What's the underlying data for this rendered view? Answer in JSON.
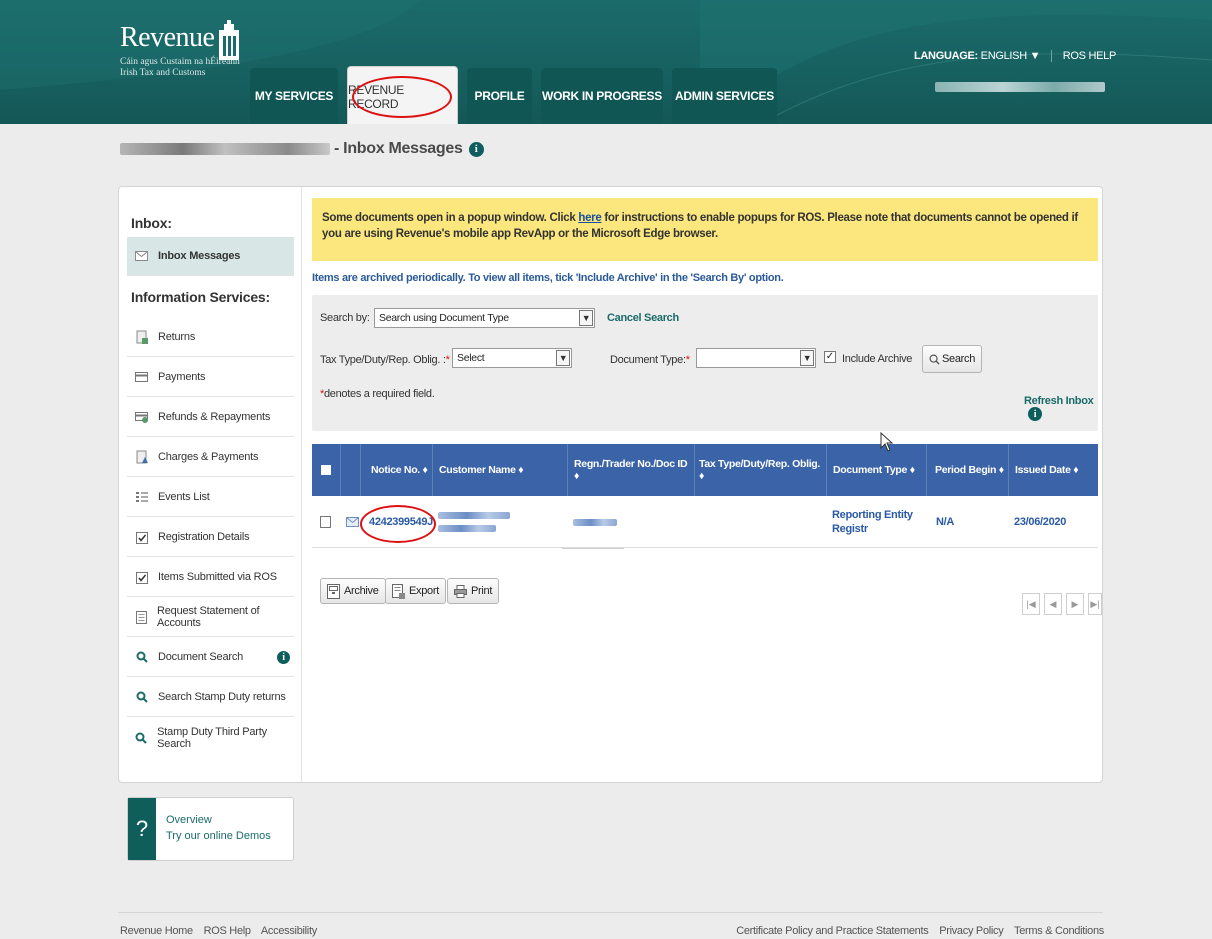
{
  "header": {
    "logo": {
      "word": "Revenue",
      "sub1": "Cáin agus Custaim na hÉireann",
      "sub2": "Irish Tax and Customs"
    },
    "tabs": [
      "MY SERVICES",
      "REVENUE RECORD",
      "PROFILE",
      "WORK IN PROGRESS",
      "ADMIN SERVICES"
    ],
    "active_tab": "REVENUE RECORD",
    "language_label": "LANGUAGE:",
    "language_value": "ENGLISH",
    "ros_help": "ROS HELP"
  },
  "page": {
    "title": "- Inbox Messages"
  },
  "sidebar": {
    "inbox_heading": "Inbox:",
    "inbox_item": "Inbox Messages",
    "info_heading": "Information Services:",
    "items": [
      {
        "label": "Returns",
        "icon": "returns-icon"
      },
      {
        "label": "Payments",
        "icon": "card-icon"
      },
      {
        "label": "Refunds & Repayments",
        "icon": "refund-icon"
      },
      {
        "label": "Charges & Payments",
        "icon": "charges-icon"
      },
      {
        "label": "Events List",
        "icon": "list-icon"
      },
      {
        "label": "Registration Details",
        "icon": "check-icon"
      },
      {
        "label": "Items Submitted via ROS",
        "icon": "check-icon"
      },
      {
        "label": "Request Statement of Accounts",
        "icon": "doc-icon"
      },
      {
        "label": "Document Search",
        "icon": "search-icon"
      },
      {
        "label": "Search Stamp Duty returns",
        "icon": "search-icon"
      },
      {
        "label": "Stamp Duty Third Party Search",
        "icon": "search-icon"
      }
    ],
    "demo": {
      "line1": "Overview",
      "line2": "Try our online Demos"
    }
  },
  "notice": {
    "text_before": "Some documents open in a popup window. Click ",
    "link": "here",
    "text_after": " for instructions to enable popups for ROS. Please note that documents cannot be opened if you are using Revenue's mobile app RevApp or the Microsoft Edge browser."
  },
  "archive_note": "Items are archived periodically. To view all items, tick 'Include Archive' in the 'Search By' option.",
  "search": {
    "search_by_label": "Search by:",
    "search_by_value": "Search using Document Type",
    "cancel": "Cancel Search",
    "tax_type_label": "Tax Type/Duty/Rep. Oblig. :",
    "tax_type_value": "Select",
    "doc_type_label": "Document Type:",
    "doc_type_value": "",
    "include_archive": "Include Archive",
    "include_archive_checked": true,
    "search_button": "Search",
    "required_note": "denotes a required field.",
    "refresh": "Refresh Inbox"
  },
  "table": {
    "columns": [
      "Notice No. ♦",
      "Customer Name ♦",
      "Regn./Trader No./Doc ID ♦",
      "Tax Type/Duty/Rep. Oblig. ♦",
      "Document Type ♦",
      "Period Begin ♦",
      "Issued Date ♦"
    ],
    "rows": [
      {
        "notice_no": "4242399549J",
        "document_type": "Reporting Entity Registr",
        "period_begin": "N/A",
        "issued_date": "23/06/2020"
      }
    ]
  },
  "actions": {
    "archive": "Archive",
    "export": "Export",
    "print": "Print"
  },
  "footer": {
    "left": [
      "Revenue Home",
      "ROS Help",
      "Accessibility"
    ],
    "right": [
      "Certificate Policy and Practice Statements",
      "Privacy Policy",
      "Terms & Conditions"
    ]
  },
  "colors": {
    "header": "#176060",
    "accent": "#1b6b6a",
    "table_header": "#3a63a8",
    "notice_bg": "#fbe77d",
    "highlight_circle": "#dd1111"
  }
}
